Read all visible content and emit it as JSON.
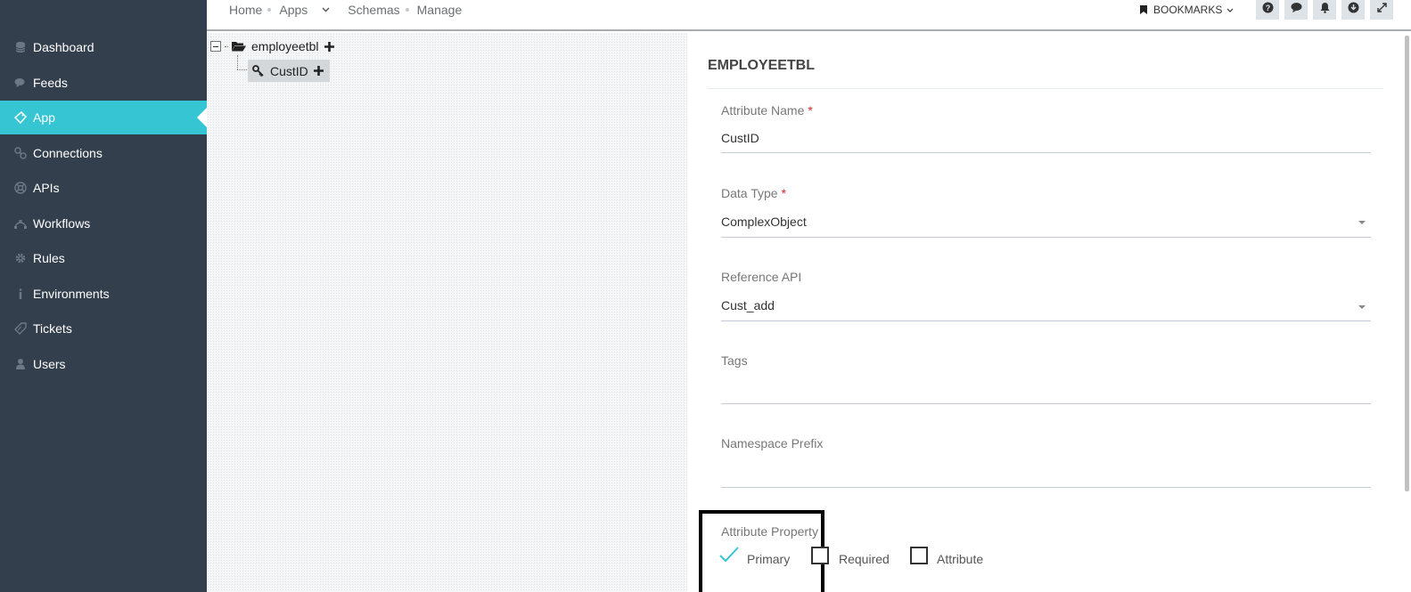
{
  "sidebar": {
    "items": [
      {
        "label": "Dashboard",
        "icon": "database-icon",
        "active": false
      },
      {
        "label": "Feeds",
        "icon": "comments-icon",
        "active": false
      },
      {
        "label": "App",
        "icon": "app-icon",
        "active": true
      },
      {
        "label": "Connections",
        "icon": "link-icon",
        "active": false
      },
      {
        "label": "APIs",
        "icon": "life-ring-icon",
        "active": false
      },
      {
        "label": "Workflows",
        "icon": "workflow-icon",
        "active": false
      },
      {
        "label": "Rules",
        "icon": "gear-icon",
        "active": false
      },
      {
        "label": "Environments",
        "icon": "info-icon",
        "active": false
      },
      {
        "label": "Tickets",
        "icon": "ticket-icon",
        "active": false
      },
      {
        "label": "Users",
        "icon": "user-icon",
        "active": false
      }
    ]
  },
  "breadcrumb": {
    "home": "Home",
    "apps": "Apps",
    "schemas": "Schemas",
    "manage": "Manage"
  },
  "topbar": {
    "bookmarks_label": "BOOKMARKS",
    "buttons": [
      "help-icon",
      "chat-icon",
      "bell-icon",
      "download-icon",
      "expand-icon"
    ]
  },
  "tree": {
    "root_label": "employeetbl",
    "child_label": "CustID"
  },
  "form": {
    "title": "EMPLOYEETBL",
    "attribute_name": {
      "label": "Attribute Name",
      "required_mark": "*",
      "value": "CustID"
    },
    "data_type": {
      "label": "Data Type",
      "required_mark": "*",
      "value": "ComplexObject"
    },
    "reference_api": {
      "label": "Reference API",
      "value": "Cust_add"
    },
    "tags": {
      "label": "Tags",
      "value": ""
    },
    "namespace_prefix": {
      "label": "Namespace Prefix",
      "value": ""
    },
    "attribute_property": {
      "label": "Attribute Property",
      "options": [
        {
          "label": "Primary",
          "checked": true
        },
        {
          "label": "Required",
          "checked": false
        },
        {
          "label": "Attribute",
          "checked": false
        }
      ]
    }
  },
  "colors": {
    "sidebar_bg": "#333f4d",
    "accent": "#36c6d3",
    "topbar_button_bg": "#dde3e7",
    "required_star": "#e02222"
  }
}
